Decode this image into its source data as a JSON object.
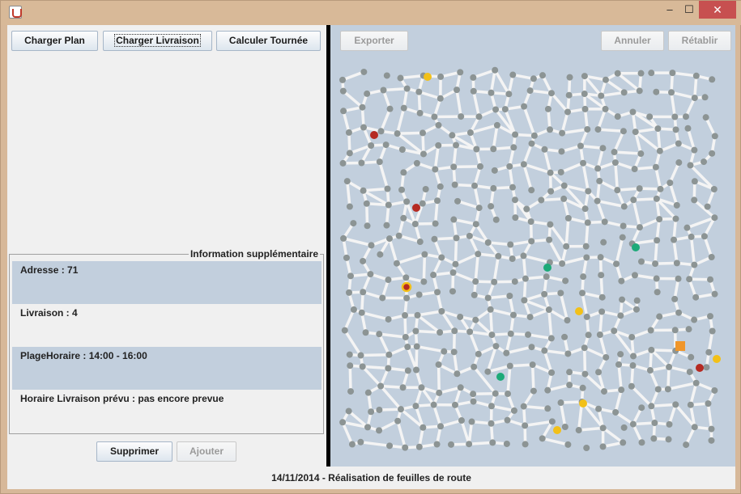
{
  "toolbar": {
    "charger_plan": "Charger Plan",
    "charger_livraison": "Charger Livraison",
    "calculer_tournee": "Calculer Tournée",
    "exporter": "Exporter",
    "annuler": "Annuler",
    "retablir": "Rétablir"
  },
  "info": {
    "title": "Information supplémentaire",
    "adresse": "Adresse : 71",
    "livraison": "Livraison : 4",
    "plage_horaire": "PlageHoraire : 14:00 - 16:00",
    "horaire_prevu": "Horaire Livraison prévu :  pas encore prevue"
  },
  "actions": {
    "supprimer": "Supprimer",
    "ajouter": "Ajouter"
  },
  "status": {
    "text": "14/11/2014 - Réalisation de feuilles de route"
  },
  "map": {
    "colors": {
      "background": "#c2cfdd",
      "road": "#f4f4f4",
      "node": "#8c9494",
      "yellow": "#f2c018",
      "red": "#b52a22",
      "green": "#1daa78",
      "warehouse": "#f0962a"
    }
  }
}
